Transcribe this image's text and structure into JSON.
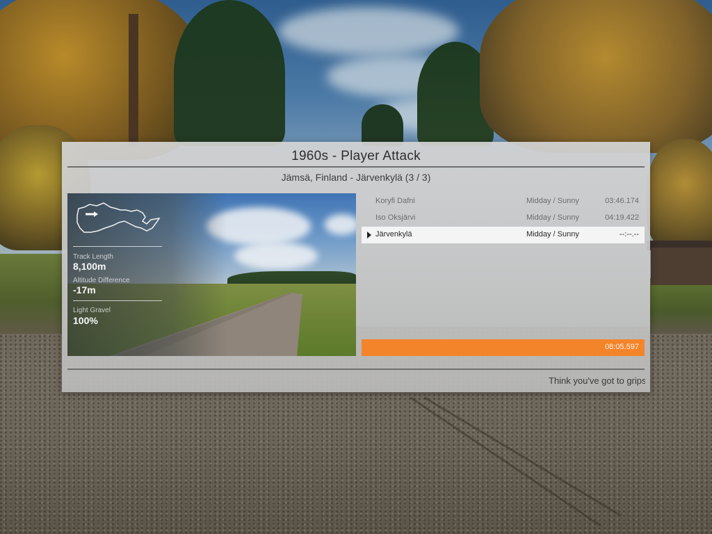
{
  "event": {
    "title": "1960s - Player Attack",
    "subtitle": "Jämsä, Finland - Järvenkylä (3 / 3)"
  },
  "preview": {
    "track_length_label": "Track Length",
    "track_length_value": "8,100m",
    "altitude_label": "Altitude Difference",
    "altitude_value": "-17m",
    "surface_label": "Light Gravel",
    "surface_value": "100%",
    "map_icon": "track-map-with-start-arrow"
  },
  "stages": [
    {
      "name": "Koryfi Dafni",
      "conditions": "Midday / Sunny",
      "time": "03:46.174",
      "selected": false
    },
    {
      "name": "Iso Oksjärvi",
      "conditions": "Midday / Sunny",
      "time": "04:19.422",
      "selected": false
    },
    {
      "name": "Järvenkylä",
      "conditions": "Midday / Sunny",
      "time": "--:--.--",
      "selected": true
    }
  ],
  "total": {
    "time": "08:05.597"
  },
  "ticker": {
    "text": "Think you've got to grips w"
  },
  "colors": {
    "accent": "#f4842a",
    "selected_row": "#f4f4f4"
  }
}
